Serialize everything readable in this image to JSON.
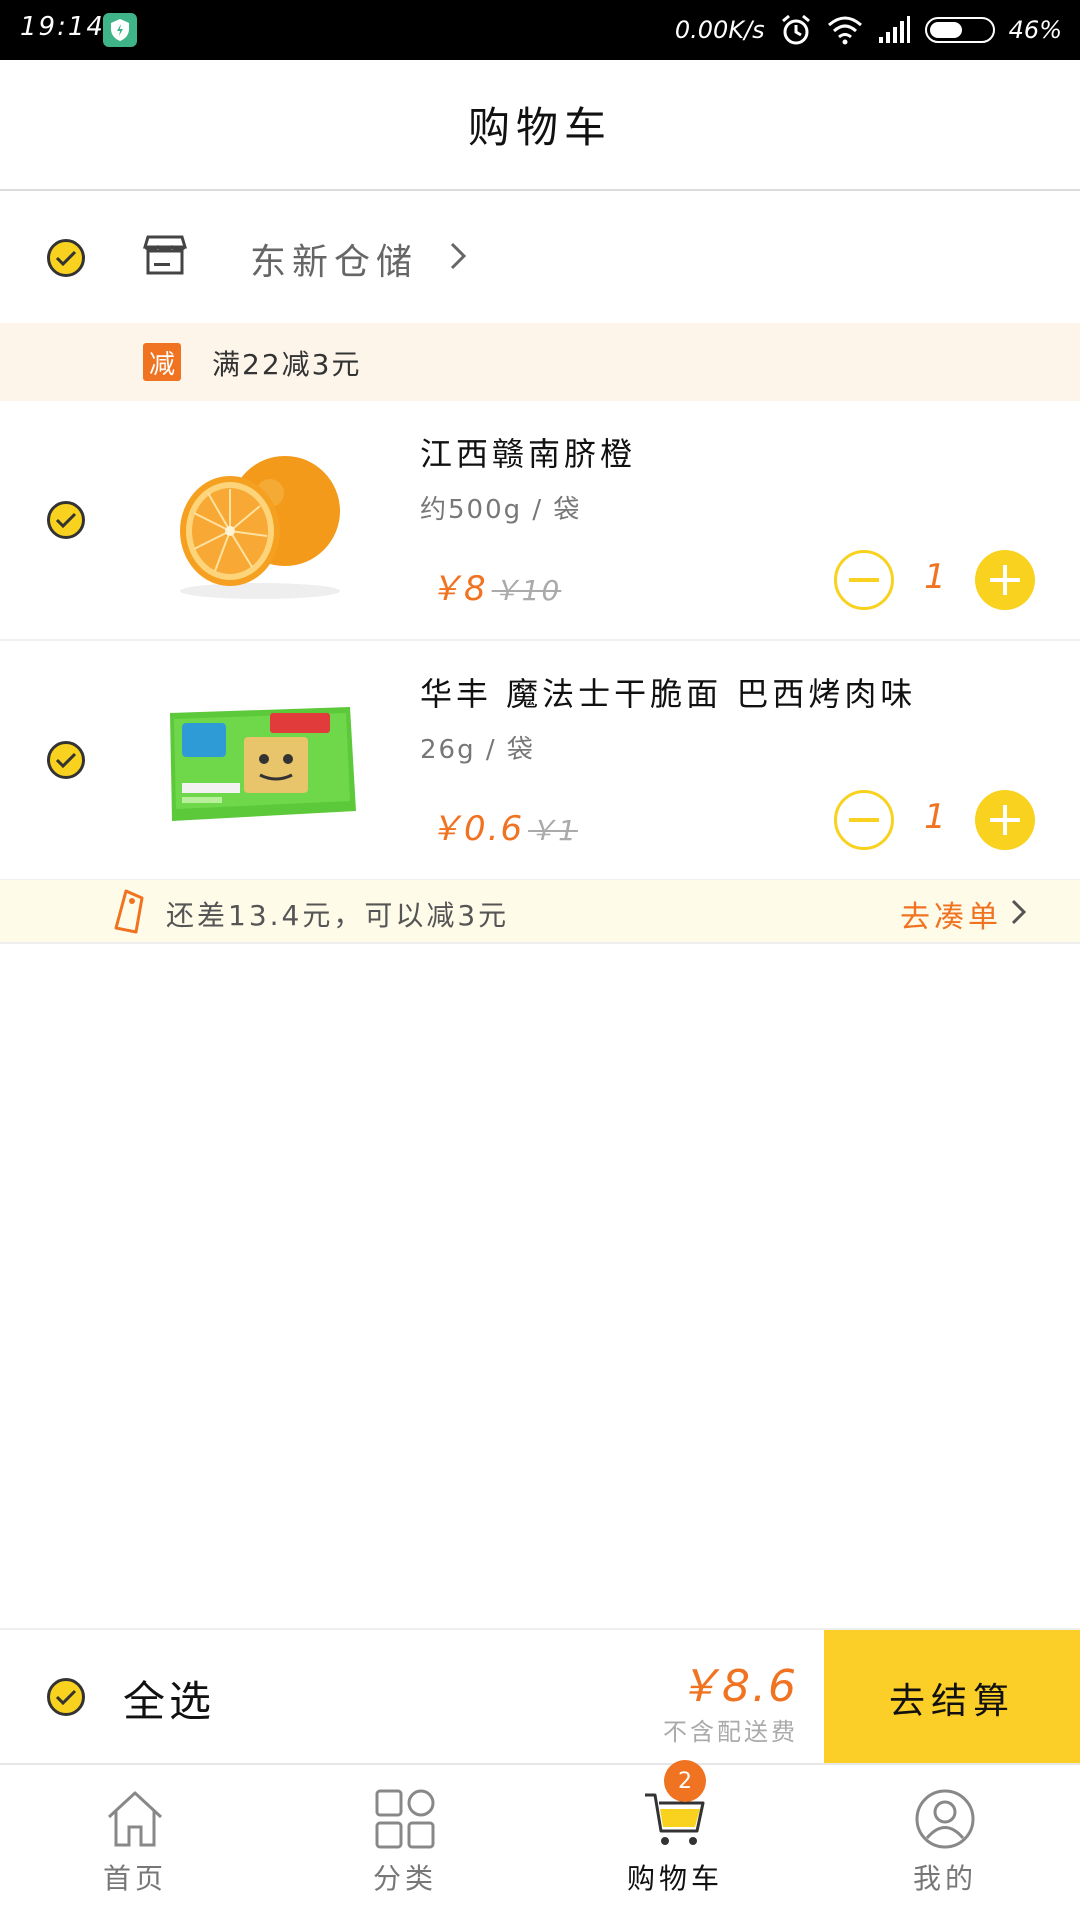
{
  "status_bar": {
    "time": "19:14",
    "net_speed": "0.00K/s",
    "battery": "46%"
  },
  "header": {
    "title": "购物车"
  },
  "store": {
    "name": "东新仓储"
  },
  "promo": {
    "tag": "减",
    "text": "满22减3元"
  },
  "items": [
    {
      "name": "江西赣南脐橙",
      "spec": "约500g / 袋",
      "price": "￥8",
      "original_price": "￥10",
      "quantity": "1"
    },
    {
      "name": "华丰 魔法士干脆面 巴西烤肉味",
      "spec": "26g / 袋",
      "price": "￥0.6",
      "original_price": "￥1",
      "quantity": "1"
    }
  ],
  "promo_gap": {
    "text": "还差13.4元，可以减3元",
    "link": "去凑单"
  },
  "checkout": {
    "select_all": "全选",
    "total": "￥8.6",
    "note": "不含配送费",
    "pay_button": "去结算"
  },
  "nav": {
    "items": [
      {
        "label": "首页",
        "icon": "home-icon"
      },
      {
        "label": "分类",
        "icon": "category-grid-icon"
      },
      {
        "label": "购物车",
        "icon": "cart-icon",
        "active": true
      },
      {
        "label": "我的",
        "icon": "profile-icon"
      }
    ],
    "cart_badge": "2"
  },
  "colors": {
    "accent_yellow": "#fcce28",
    "accent_orange": "#f07322",
    "promo_bg": "#fdf4ea",
    "gap_bg": "#fefbe8"
  }
}
